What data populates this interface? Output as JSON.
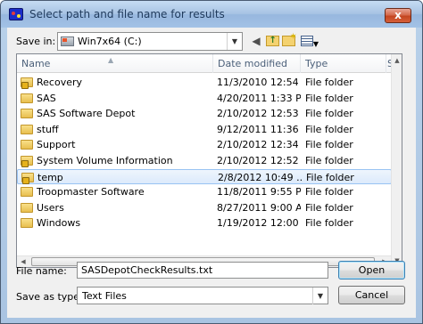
{
  "window": {
    "title": "Select path and file name for results",
    "close_glyph": "x",
    "app_icon": "sas-app-icon"
  },
  "toolbar": {
    "save_in_label": "Save in:",
    "save_in_value": "Win7x64 (C:)",
    "save_in_icon": "drive-icon",
    "buttons": [
      "back-icon",
      "up-folder-icon",
      "new-folder-icon",
      "views-menu-icon"
    ]
  },
  "columns": {
    "name": "Name",
    "date": "Date modified",
    "type": "Type",
    "more": "S"
  },
  "files": [
    {
      "name": "Recovery",
      "date": "11/3/2010 12:54 ...",
      "type": "File folder",
      "locked": true,
      "selected": false
    },
    {
      "name": "SAS",
      "date": "4/20/2011 1:33 PM",
      "type": "File folder",
      "locked": false,
      "selected": false
    },
    {
      "name": "SAS Software Depot",
      "date": "2/10/2012 12:53 ...",
      "type": "File folder",
      "locked": false,
      "selected": false
    },
    {
      "name": "stuff",
      "date": "9/12/2011 11:36 ...",
      "type": "File folder",
      "locked": false,
      "selected": false
    },
    {
      "name": "Support",
      "date": "2/10/2012 12:34 ...",
      "type": "File folder",
      "locked": false,
      "selected": false
    },
    {
      "name": "System Volume Information",
      "date": "2/10/2012 12:52 ...",
      "type": "File folder",
      "locked": true,
      "selected": false
    },
    {
      "name": "temp",
      "date": "2/8/2012 10:49 ...",
      "type": "File folder",
      "locked": true,
      "selected": true
    },
    {
      "name": "Troopmaster Software",
      "date": "11/8/2011 9:55 PM",
      "type": "File folder",
      "locked": false,
      "selected": false
    },
    {
      "name": "Users",
      "date": "8/27/2011 9:00 AM",
      "type": "File folder",
      "locked": false,
      "selected": false
    },
    {
      "name": "Windows",
      "date": "1/19/2012 12:00 ...",
      "type": "File folder",
      "locked": false,
      "selected": false
    }
  ],
  "filename": {
    "label": "File name:",
    "value": "SASDepotCheckResults.txt"
  },
  "save_type": {
    "label": "Save as type:",
    "value": "Text Files"
  },
  "buttons": {
    "open": "Open",
    "cancel": "Cancel"
  },
  "colors": {
    "title_text": "#1e395b",
    "selection_border": "#99c3f3",
    "folder": "#e8bf4f"
  }
}
